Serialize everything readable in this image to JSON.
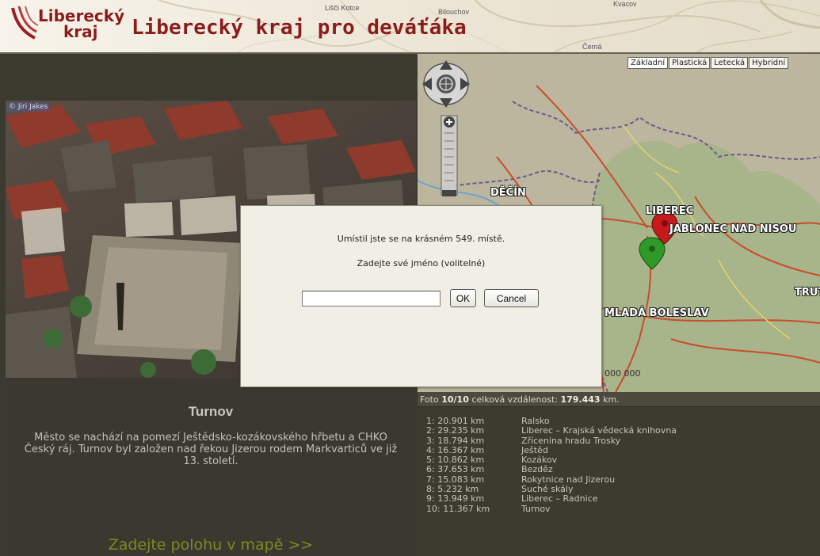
{
  "header": {
    "logo_line1": "Liberecký",
    "logo_line2": "kraj",
    "title": "Liberecký kraj pro deváťáka",
    "bg_labels": [
      "Lišči Kotce",
      "Bilouchov",
      "Černá",
      "Kvacov"
    ]
  },
  "photo": {
    "credit": "© Jiri Jakes"
  },
  "place": {
    "title": "Turnov",
    "description": "Město se nachází na pomezí Ještědsko-kozákovského hřbetu a CHKO Český ráj. Turnov byl založen nad řekou Jizerou rodem Markvarticů ve již 13. století.",
    "enter_link": "Zadejte polohu v mapě >>"
  },
  "map": {
    "types": [
      "Základní",
      "Plastická",
      "Letecká",
      "Hybridní"
    ],
    "active_type": "Základní",
    "labels": [
      "DĚČÍN",
      "LIBEREC",
      "JABLONEC NAD NISOU",
      "MLADÁ BOLESLAV",
      "TRUT"
    ],
    "scale": "000 000",
    "marker_colors": {
      "red": "#c8191b",
      "green": "#2f9a2a"
    }
  },
  "results": {
    "summary_prefix": "Foto",
    "photo_index": "10/10",
    "summary_middle": "celková vzdálenost:",
    "total_distance": "179.443",
    "summary_unit": "km.",
    "rows": [
      {
        "dist": "1: 20.901 km",
        "name": "Ralsko"
      },
      {
        "dist": "2: 29.235 km",
        "name": "Liberec – Krajská vědecká knihovna"
      },
      {
        "dist": "3: 18.794 km",
        "name": "Zřícenina hradu Trosky"
      },
      {
        "dist": "4: 16.367 km",
        "name": "Ještěd"
      },
      {
        "dist": "5: 10.862 km",
        "name": "Kozákov"
      },
      {
        "dist": "6: 37.653 km",
        "name": "Bezděz"
      },
      {
        "dist": "7: 15.083 km",
        "name": "Rokytnice nad Jizerou"
      },
      {
        "dist": "8: 5.232 km",
        "name": "Suché skály"
      },
      {
        "dist": "9: 13.949 km",
        "name": "Liberec – Radnice"
      },
      {
        "dist": "10: 11.367 km",
        "name": "Turnov"
      }
    ]
  },
  "dialog": {
    "message": "Umístil jste se na krásném 549. místě.",
    "prompt": "Zadejte své jméno (volitelné)",
    "input_value": "",
    "ok_label": "OK",
    "cancel_label": "Cancel"
  }
}
